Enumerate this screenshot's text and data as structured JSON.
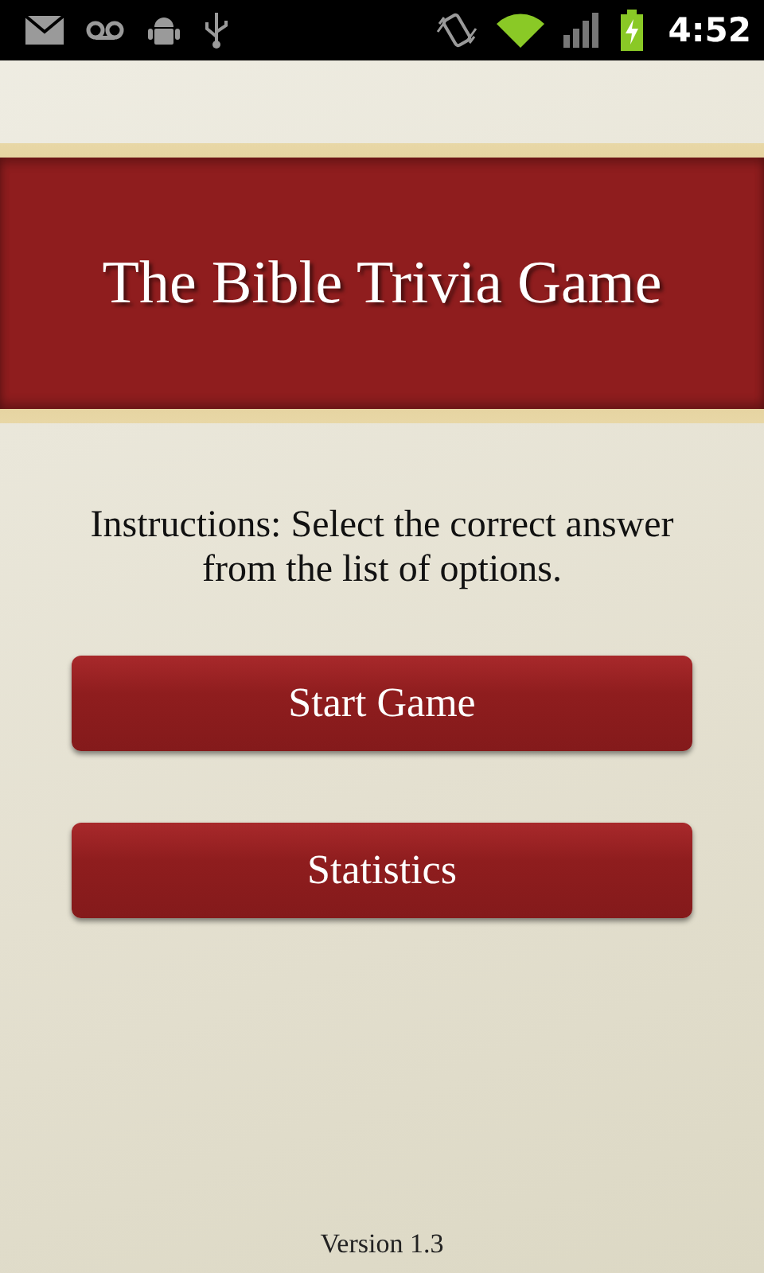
{
  "status_bar": {
    "time": "4:52"
  },
  "title": "The Bible Trivia Game",
  "instructions": "Instructions: Select the correct answer from the list of options.",
  "buttons": [
    "Start Game",
    "Statistics"
  ],
  "version": "Version 1.3"
}
